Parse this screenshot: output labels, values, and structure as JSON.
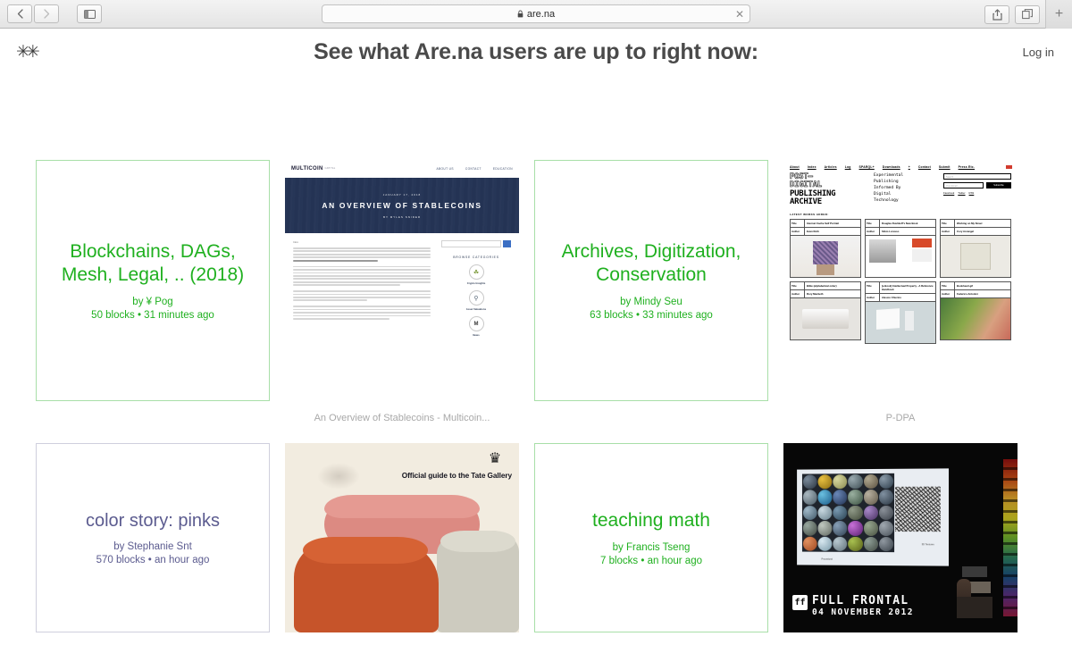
{
  "browser": {
    "back_label": "‹",
    "forward_label": "›",
    "url_text": "are.na",
    "stop_label": "✕",
    "new_tab_label": "+"
  },
  "header": {
    "logo_glyph": "✳✳",
    "title": "See what Are.na users are up to right now:",
    "login_label": "Log in"
  },
  "colors": {
    "public_green": "#1fb01f",
    "private_purple": "#5b5b8f",
    "caption_grey": "#a8a8a8"
  },
  "cards": [
    {
      "kind": "channel",
      "accent": "green",
      "title": "Blockchains, DAGs, Mesh, Legal, .. (2018)",
      "author": "by ¥ Pog",
      "meta": "50 blocks • 31 minutes ago"
    },
    {
      "kind": "block",
      "caption": "An Overview of Stablecoins - Multicoin...",
      "site": {
        "logo": "MULTICOIN",
        "logo_sub": "CAPITAL",
        "nav": [
          "ABOUT US",
          "CONTACT",
          "EDUCATION"
        ],
        "hero_date": "JANUARY 17, 2018",
        "hero_title": "AN OVERVIEW OF STABLECOINS",
        "hero_byline": "BY MYLES SNIDER",
        "body_label": "Intro",
        "search_placeholder": "",
        "categories_title": "BROWSE CATEGORIES",
        "categories": [
          {
            "icon": "lightbulb-icon",
            "glyph": "○",
            "label": "Crypto Insights"
          },
          {
            "icon": "magnifier-icon",
            "glyph": "○",
            "label": "Asset Valuations"
          },
          {
            "icon": "news-icon",
            "glyph": "M",
            "label": "News"
          }
        ]
      }
    },
    {
      "kind": "channel",
      "accent": "green",
      "title": "Archives, Digitization, Conservation",
      "author": "by Mindy Seu",
      "meta": "63 blocks • 33 minutes ago"
    },
    {
      "kind": "block",
      "caption": "P-DPA",
      "site": {
        "nav": [
          "About",
          "Index",
          "Articles",
          "Log",
          "SPARQL+",
          "Downloads",
          "+",
          "Contact",
          "Submit",
          "Press Etc."
        ],
        "logo_lines": [
          "POST—",
          "DIGITAL",
          "PUBLISHING",
          "ARCHIVE"
        ],
        "tagline": [
          "Experimental",
          "Publishing",
          "Informed By",
          "Digital",
          "Technology"
        ],
        "search_placeholder": "Search",
        "email_placeholder": "Your Email",
        "subscribe_label": "Subscribe",
        "social": [
          "Facebook",
          "Twitter",
          "RSS"
        ],
        "latest_label": "LATEST WORKS ADDED:",
        "key_title": "Title",
        "key_author": "Author",
        "entries": [
          {
            "title": "Internet Cache Self Portrait",
            "author": "Evan Roth"
          },
          {
            "title": "Douglas Rushkoff's New Book",
            "author": "Silvio Lorusso"
          },
          {
            "title": "Working on My Novel",
            "author": "Cory Arcangel"
          },
          {
            "title": "Bible (alphabetical order)",
            "author": "Rory Macbeth"
          },
          {
            "title": "[e-Book] Intellectual Property - A Reference Handbook",
            "author": "Alessio Chierico"
          },
          {
            "title": "Bookheart.gif",
            "author": "Federico Antonini"
          }
        ]
      }
    },
    {
      "kind": "channel",
      "accent": "purple",
      "title": "color story: pinks",
      "author": "by Stephanie Snt",
      "meta": "570 blocks • an hour ago"
    },
    {
      "kind": "block",
      "caption": "",
      "site": {
        "cover_text": "Official guide to the Tate Gallery",
        "crest_glyph": "♛"
      }
    },
    {
      "kind": "channel",
      "accent": "green",
      "title": "teaching math",
      "author": "by Francis Tseng",
      "meta": "7 blocks • an hour ago"
    },
    {
      "kind": "block",
      "caption": "",
      "site": {
        "logo_text": "ff",
        "brand_line1": "FULL FRONTAL",
        "brand_line2": "04 NOVEMBER 2012",
        "slide_caption_left": "Procedural",
        "slide_caption_right": "3D Textures"
      }
    }
  ]
}
